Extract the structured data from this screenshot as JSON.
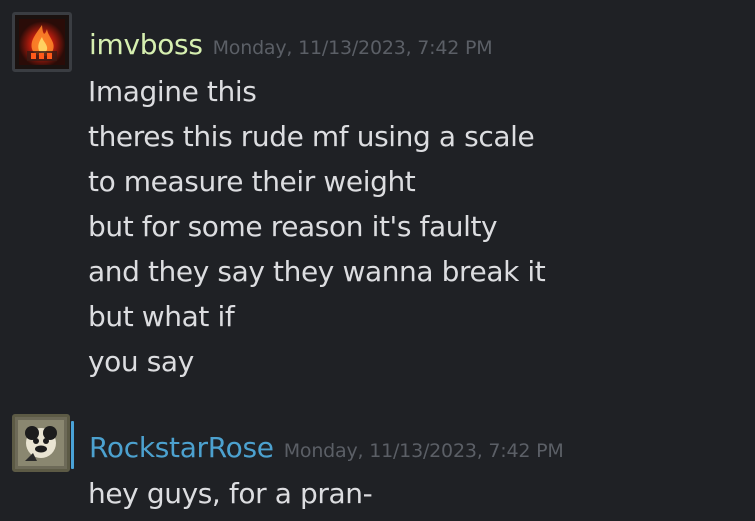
{
  "colors": {
    "background": "#1f2125",
    "username_online": "#d6efb0",
    "username_ingame": "#4ca1cf",
    "timestamp": "#5b5f66",
    "message_text": "#dcdde0",
    "status_bar": "#4aa3d8"
  },
  "messages": [
    {
      "username": "imvboss",
      "timestamp": "Monday, 11/13/2023, 7:42 PM",
      "avatar_icon": "fire-avatar-icon",
      "lines": [
        "Imagine this",
        "theres this rude mf using a scale",
        "to measure their weight",
        "but for some reason it's faulty",
        "and they say they wanna break it",
        "but what if",
        "you say"
      ]
    },
    {
      "username": "RockstarRose",
      "timestamp": "Monday, 11/13/2023, 7:42 PM",
      "avatar_icon": "cartoon-character-avatar-icon",
      "lines": [
        "hey guys, for a pran-"
      ]
    }
  ]
}
